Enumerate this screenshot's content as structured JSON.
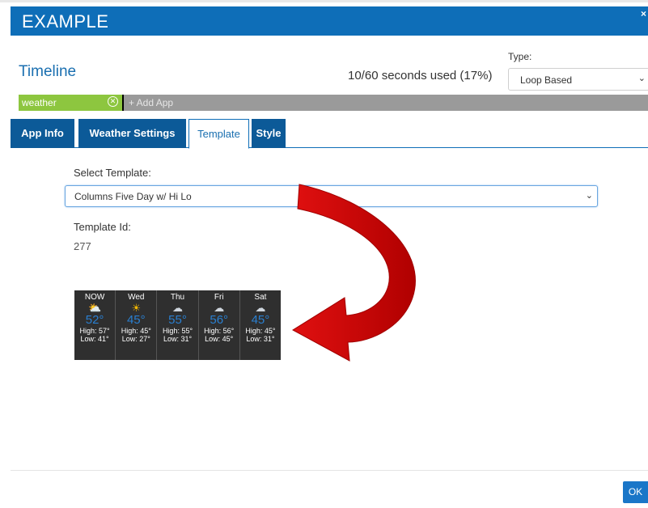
{
  "dialog": {
    "title": "EXAMPLE",
    "close_glyph": "×"
  },
  "timeline": {
    "title": "Timeline",
    "seconds_used": "10/60 seconds used (17%)",
    "type_label": "Type:",
    "type_value": "Loop Based"
  },
  "app_bar": {
    "chip_label": "weather",
    "add_app": "+ Add App"
  },
  "tabs": [
    {
      "label": "App Info"
    },
    {
      "label": "Weather Settings"
    },
    {
      "label": "Template"
    },
    {
      "label": "Style"
    }
  ],
  "template": {
    "select_label": "Select Template:",
    "select_value": "Columns Five Day w/ Hi Lo",
    "id_label": "Template Id:",
    "id_value": "277"
  },
  "forecast": [
    {
      "day": "NOW",
      "icon": "partly-cloudy-icon",
      "temp": "52°",
      "high": "High: 57°",
      "low": "Low: 41°"
    },
    {
      "day": "Wed",
      "icon": "sun-icon",
      "temp": "45°",
      "high": "High: 45°",
      "low": "Low: 27°"
    },
    {
      "day": "Thu",
      "icon": "rain-icon",
      "temp": "55°",
      "high": "High: 55°",
      "low": "Low: 31°"
    },
    {
      "day": "Fri",
      "icon": "rain-icon",
      "temp": "56°",
      "high": "High: 56°",
      "low": "Low: 45°"
    },
    {
      "day": "Sat",
      "icon": "rain-icon",
      "temp": "45°",
      "high": "High: 45°",
      "low": "Low: 31°"
    }
  ],
  "footer": {
    "ok_label": "OK"
  },
  "colors": {
    "header_blue": "#0e6eb8",
    "chip_green": "#8dc63f",
    "arrow_red": "#e01010"
  }
}
